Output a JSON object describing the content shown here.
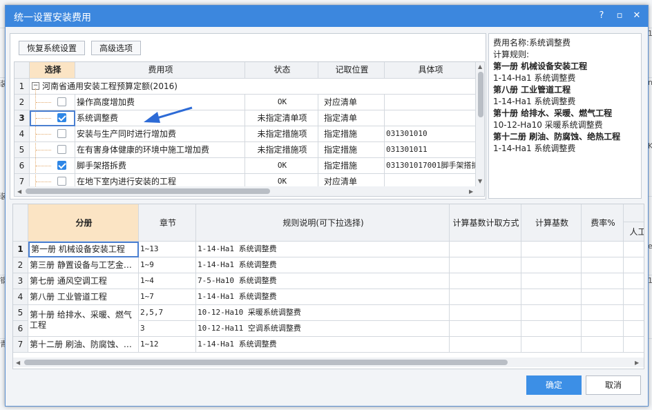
{
  "background": {
    "texts": [
      "装",
      "装",
      "钢",
      "青",
      "1",
      "n",
      "K",
      "e",
      "1"
    ]
  },
  "dialog": {
    "title": "统一设置安装费用",
    "help": "?",
    "restore": "▫",
    "close": "✕"
  },
  "toolbar": {
    "restore_label": "恢复系统设置",
    "advanced_label": "高级选项"
  },
  "top_grid": {
    "columns": [
      "选择",
      "费用项",
      "状态",
      "记取位置",
      "具体项"
    ],
    "rows": [
      {
        "num": "1",
        "name": "河南省通用安装工程预算定额(2016)",
        "expander": "−",
        "is_group": true
      },
      {
        "num": "2",
        "checked": false,
        "name": "操作高度增加费",
        "status": "OK",
        "position": "对应清单",
        "detail": ""
      },
      {
        "num": "3",
        "checked": true,
        "name": "系统调整费",
        "status": "未指定清单项",
        "position": "指定清单",
        "detail": ""
      },
      {
        "num": "4",
        "checked": false,
        "name": "安装与生产同时进行增加费",
        "status": "未指定措施项",
        "position": "指定措施",
        "detail": "031301010"
      },
      {
        "num": "5",
        "checked": false,
        "name": "在有害身体健康的环境中施工增加费",
        "status": "未指定措施项",
        "position": "指定措施",
        "detail": "031301011"
      },
      {
        "num": "6",
        "checked": true,
        "name": "脚手架搭拆费",
        "status": "OK",
        "position": "指定措施",
        "detail": "031301017001脚手架搭拆"
      },
      {
        "num": "7",
        "checked": false,
        "name": "在地下室内进行安装的工程",
        "status": "OK",
        "position": "对应清单",
        "detail": ""
      }
    ]
  },
  "info_panel": {
    "lines": [
      {
        "text": "费用名称:系统调整费",
        "bold": false
      },
      {
        "text": "计算规则:",
        "bold": false
      },
      {
        "text": "第一册 机械设备安装工程",
        "bold": true
      },
      {
        "text": "1-14-Ha1 系统调整费",
        "bold": false
      },
      {
        "text": "第八册 工业管道工程",
        "bold": true
      },
      {
        "text": "1-14-Ha1 系统调整费",
        "bold": false
      },
      {
        "text": "第十册 给排水、采暖、燃气工程",
        "bold": true
      },
      {
        "text": "10-12-Ha10 采暖系统调整费",
        "bold": false
      },
      {
        "text": "第十二册 刷油、防腐蚀、绝热工程",
        "bold": true
      },
      {
        "text": "1-14-Ha1 系统调整费",
        "bold": false
      }
    ]
  },
  "bottom_grid": {
    "columns": [
      "分册",
      "章节",
      "规则说明(可下拉选择)",
      "计算基数计取方式",
      "计算基数",
      "费率%",
      "人工"
    ],
    "rows": [
      {
        "num": "1",
        "volume": "第一册 机械设备安装工程",
        "chapter": "1~13",
        "rule": "1-14-Ha1 系统调整费"
      },
      {
        "num": "2",
        "volume": "第三册 静置设备与工艺金…",
        "chapter": "1~9",
        "rule": "1-14-Ha1 系统调整费"
      },
      {
        "num": "3",
        "volume": "第七册 通风空调工程",
        "chapter": "1~4",
        "rule": "7-5-Ha10 系统调整费"
      },
      {
        "num": "4",
        "volume": "第八册 工业管道工程",
        "chapter": "1~7",
        "rule": "1-14-Ha1 系统调整费"
      },
      {
        "num": "5",
        "volume": "第十册 给排水、采暖、燃气",
        "chapter": "2,5,7",
        "rule": "10-12-Ha10 采暖系统调整费"
      },
      {
        "num": "6",
        "volume": "工程",
        "chapter": "3",
        "rule": "10-12-Ha11 空调系统调整费"
      },
      {
        "num": "7",
        "volume": "第十二册 刷油、防腐蚀、…",
        "chapter": "1~12",
        "rule": "1-14-Ha1 系统调整费"
      }
    ]
  },
  "footer": {
    "ok_label": "确定",
    "cancel_label": "取消"
  },
  "colors": {
    "titlebar": "#3c87de",
    "accent": "#2e86e6",
    "selected_header": "#fbe4c4",
    "annotation_arrow": "#2d6bd6"
  }
}
